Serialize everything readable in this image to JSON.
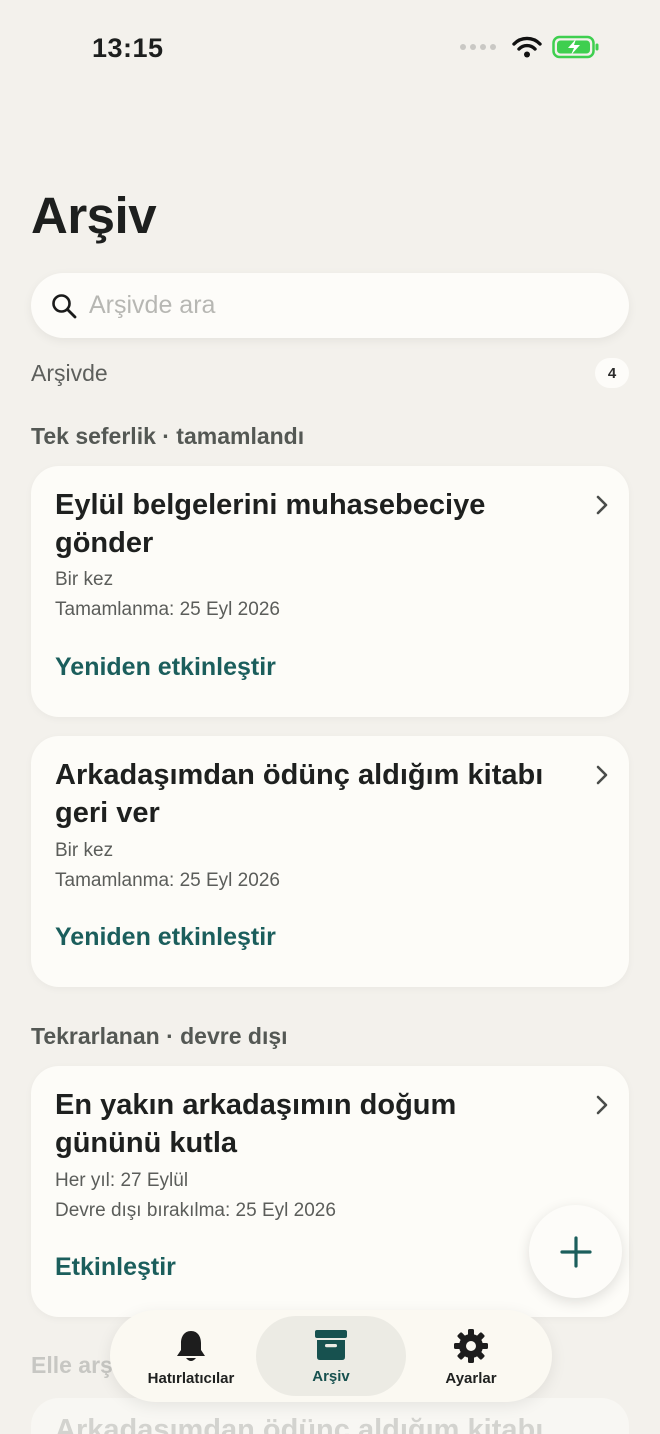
{
  "status_bar": {
    "time": "13:15"
  },
  "page": {
    "title": "Arşiv"
  },
  "search": {
    "placeholder": "Arşivde ara"
  },
  "archive_summary": {
    "label": "Arşivde",
    "count": "4"
  },
  "sections": [
    {
      "header": "Tek seferlik · tamamlandı",
      "cards": [
        {
          "title": "Eylül belgelerini muhasebeciye gönder",
          "meta1": "Bir kez",
          "meta2": "Tamamlanma: 25 Eyl 2026",
          "action": "Yeniden etkinleştir"
        },
        {
          "title": "Arkadaşımdan ödünç aldığım kitabı geri ver",
          "meta1": "Bir kez",
          "meta2": "Tamamlanma: 25 Eyl 2026",
          "action": "Yeniden etkinleştir"
        }
      ]
    },
    {
      "header": "Tekrarlanan · devre dışı",
      "cards": [
        {
          "title": "En yakın arkadaşımın doğum gününü kutla",
          "meta1": "Her yıl: 27 Eylül",
          "meta2": "Devre dışı bırakılma: 25 Eyl 2026",
          "action": "Etkinleştir"
        }
      ]
    },
    {
      "header": "Elle arşivlendi",
      "cards": [
        {
          "title": "Arkadaşımdan ödünç aldığım kitabı"
        }
      ]
    }
  ],
  "tabbar": {
    "tabs": [
      {
        "label": "Hatırlatıcılar",
        "icon": "bell-icon",
        "active": false
      },
      {
        "label": "Arşiv",
        "icon": "archive-box-icon",
        "active": true
      },
      {
        "label": "Ayarlar",
        "icon": "gear-icon",
        "active": false
      }
    ]
  },
  "colors": {
    "background": "#f3f1ec",
    "card": "#fdfcf8",
    "accent": "#1b5e5c",
    "battery": "#3ecf4f"
  }
}
